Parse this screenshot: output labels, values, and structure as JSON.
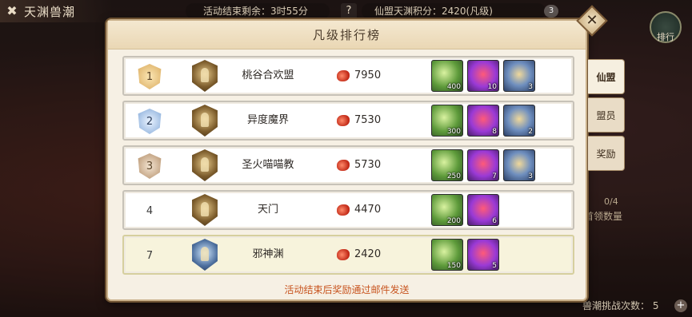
{
  "topbar": {
    "title": "天渊兽潮",
    "timer": "活动结束剩余：3时55分",
    "help": "?",
    "score": "仙盟天渊积分：2420(凡级)",
    "badge": "3"
  },
  "rank_button": {
    "label": "排行"
  },
  "side": {
    "count": "0/4",
    "label": "首领数量",
    "challenge": "兽潮挑战次数： 5"
  },
  "panel": {
    "title": "凡级排行榜",
    "footer": "活动结束后奖励通过邮件发送"
  },
  "tabs": [
    "仙盟",
    "盟员",
    "奖励"
  ],
  "rows": [
    {
      "rank": "1",
      "name": "桃谷合欢盟",
      "score": "7950",
      "rewards": [
        "400",
        "10",
        "3"
      ]
    },
    {
      "rank": "2",
      "name": "异度魔界",
      "score": "7530",
      "rewards": [
        "300",
        "8",
        "2"
      ]
    },
    {
      "rank": "3",
      "name": "圣火喵喵教",
      "score": "5730",
      "rewards": [
        "250",
        "7",
        "3"
      ]
    },
    {
      "rank": "4",
      "name": "天门",
      "score": "4470",
      "rewards": [
        "200",
        "6"
      ]
    },
    {
      "rank": "7",
      "name": "邪神渊",
      "score": "2420",
      "rewards": [
        "150",
        "5"
      ]
    }
  ],
  "colors": {
    "panel_bg": "#f6f0e4",
    "footer_text": "#c8541f",
    "mine_row": "#f7f3dc"
  }
}
